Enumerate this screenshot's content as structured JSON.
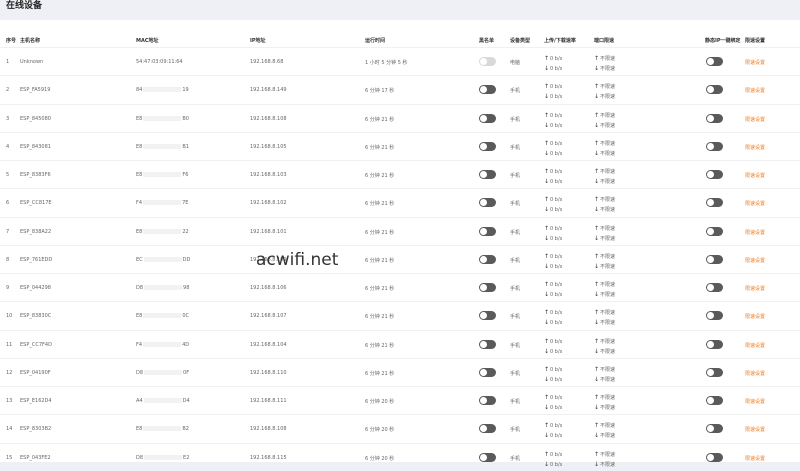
{
  "page": {
    "title": "在线设备"
  },
  "watermark": "acwifi.net",
  "colors": {
    "accent": "#f07b1d",
    "toggle_off": "#5a5a5a"
  },
  "table": {
    "headers": {
      "index": "序号",
      "hostname": "主机名称",
      "mac": "MAC地址",
      "ip": "IP地址",
      "uptime": "运行时间",
      "blacklist": "黑名单",
      "device_type": "设备类型",
      "rate": "上传/下载速率",
      "port_limit": "端口限速",
      "static_ip": "静态IP一键绑定",
      "limit_set": "限速设置"
    },
    "rate_value": "0 b/s",
    "unlimited": "不限速",
    "limit_link": "限速设置",
    "rows": [
      {
        "index": "1",
        "host": "Unknown",
        "mac_a": "54:47:03:09:11:64",
        "mac_b": "",
        "ip": "192.168.8.68",
        "uptime": "1 小时 5 分钟 5 秒",
        "type": "电脑"
      },
      {
        "index": "2",
        "host": "ESP_FA5919",
        "mac_a": "84",
        "mac_b": "19",
        "ip": "192.168.8.149",
        "uptime": "6 分钟 17 秒",
        "type": "手机"
      },
      {
        "index": "3",
        "host": "ESP_845080",
        "mac_a": "E8",
        "mac_b": "B0",
        "ip": "192.168.8.108",
        "uptime": "6 分钟 21 秒",
        "type": "手机"
      },
      {
        "index": "4",
        "host": "ESP_843081",
        "mac_a": "E8",
        "mac_b": "B1",
        "ip": "192.168.8.105",
        "uptime": "6 分钟 21 秒",
        "type": "手机"
      },
      {
        "index": "5",
        "host": "ESP_8383F6",
        "mac_a": "E8",
        "mac_b": "F6",
        "ip": "192.168.8.103",
        "uptime": "6 分钟 21 秒",
        "type": "手机"
      },
      {
        "index": "6",
        "host": "ESP_CC817E",
        "mac_a": "F4",
        "mac_b": "7E",
        "ip": "192.168.8.102",
        "uptime": "6 分钟 21 秒",
        "type": "手机"
      },
      {
        "index": "7",
        "host": "ESP_838A22",
        "mac_a": "E8",
        "mac_b": "22",
        "ip": "192.168.8.101",
        "uptime": "6 分钟 21 秒",
        "type": "手机"
      },
      {
        "index": "8",
        "host": "ESP_761EDD",
        "mac_a": "EC",
        "mac_b": "DD",
        "ip": "192.168.8.109",
        "uptime": "6 分钟 21 秒",
        "type": "手机"
      },
      {
        "index": "9",
        "host": "ESP_044298",
        "mac_a": "D8",
        "mac_b": "98",
        "ip": "192.168.8.106",
        "uptime": "6 分钟 21 秒",
        "type": "手机"
      },
      {
        "index": "10",
        "host": "ESP_83830C",
        "mac_a": "E8",
        "mac_b": "0C",
        "ip": "192.168.8.107",
        "uptime": "6 分钟 21 秒",
        "type": "手机"
      },
      {
        "index": "11",
        "host": "ESP_CC7F4D",
        "mac_a": "F4",
        "mac_b": "4D",
        "ip": "192.168.8.104",
        "uptime": "6 分钟 21 秒",
        "type": "手机"
      },
      {
        "index": "12",
        "host": "ESP_04190F",
        "mac_a": "D8",
        "mac_b": "0F",
        "ip": "192.168.8.110",
        "uptime": "6 分钟 21 秒",
        "type": "手机"
      },
      {
        "index": "13",
        "host": "ESP_E162D4",
        "mac_a": "A4",
        "mac_b": "D4",
        "ip": "192.168.8.111",
        "uptime": "6 分钟 20 秒",
        "type": "手机"
      },
      {
        "index": "14",
        "host": "ESP_8303B2",
        "mac_a": "E8",
        "mac_b": "B2",
        "ip": "192.168.8.108",
        "uptime": "6 分钟 20 秒",
        "type": "手机"
      },
      {
        "index": "15",
        "host": "ESP_043FE2",
        "mac_a": "D8",
        "mac_b": "E2",
        "ip": "192.168.8.115",
        "uptime": "6 分钟 20 秒",
        "type": "手机"
      }
    ]
  }
}
